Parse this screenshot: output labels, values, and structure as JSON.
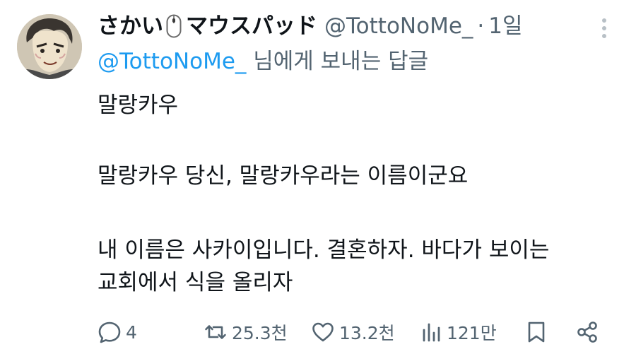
{
  "tweet": {
    "author": {
      "display_name": "さかい",
      "display_name_suffix": "マウスパッド",
      "handle": "@TottoNoMe_",
      "avatar_icon": "avatar-image"
    },
    "separator": "·",
    "time": "1일",
    "reply_to": {
      "mention": "@TottoNoMe_",
      "suffix": " 님에게 보내는 답글"
    },
    "body": {
      "p1": "말랑카우",
      "p2": "말랑카우 당신, 말랑카우라는 이름이군요",
      "p3_line1": "내 이름은 사카이입니다. 결혼하자. 바다가 보이는",
      "p3_line2": "교회에서 식을 올리자"
    },
    "actions": {
      "reply": {
        "icon": "comment-icon",
        "count": "4"
      },
      "retweet": {
        "icon": "retweet-icon",
        "count": "25.3천"
      },
      "like": {
        "icon": "heart-icon",
        "count": "13.2천"
      },
      "views": {
        "icon": "views-icon",
        "count": "121만"
      },
      "bookmark": {
        "icon": "bookmark-icon"
      },
      "share": {
        "icon": "share-icon"
      }
    },
    "more_icon": "more-vertical-icon"
  },
  "colors": {
    "text": "#0f1419",
    "secondary": "#536471",
    "link": "#1d9bf0",
    "background": "#ffffff"
  }
}
